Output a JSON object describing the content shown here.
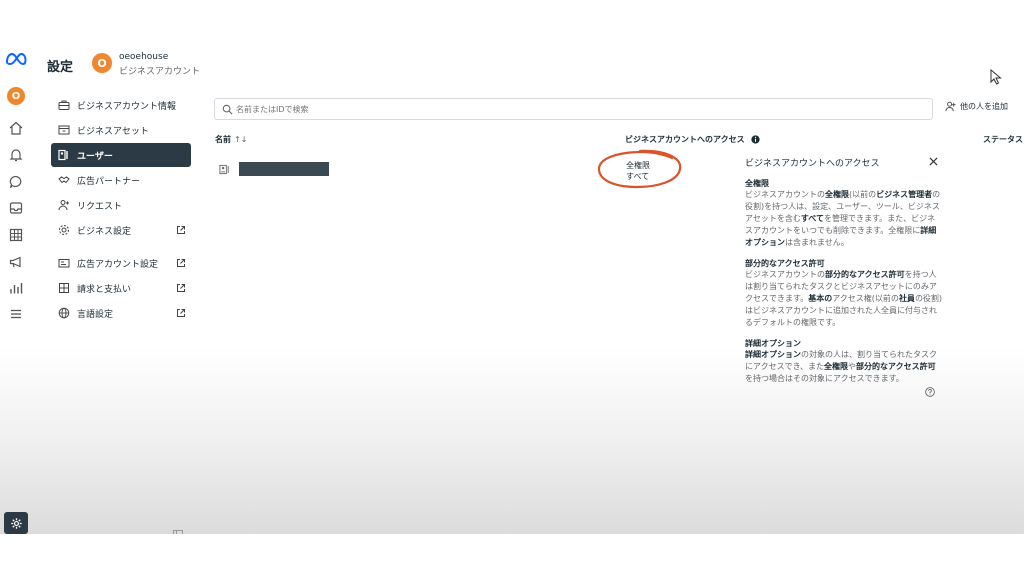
{
  "header": {
    "title": "設定",
    "account_avatar_letter": "O",
    "account_name": "oeoehouse",
    "account_type": "ビジネスアカウント"
  },
  "rail": {
    "avatar_letter": "O",
    "icons": [
      "home-icon",
      "bell-icon",
      "chat-bubble-icon",
      "inbox-icon",
      "table-icon",
      "megaphone-icon",
      "bar-chart-icon",
      "menu-icon"
    ],
    "bottom_icon": "gear-icon"
  },
  "sidebar": {
    "items": [
      {
        "label": "ビジネスアカウント情報",
        "icon": "briefcase-icon"
      },
      {
        "label": "ビジネスアセット",
        "icon": "asset-box-icon"
      },
      {
        "label": "ユーザー",
        "icon": "users-icon",
        "active": true
      },
      {
        "label": "広告パートナー",
        "icon": "handshake-icon"
      },
      {
        "label": "リクエスト",
        "icon": "person-request-icon"
      },
      {
        "label": "ビジネス設定",
        "icon": "settings-gear-icon",
        "external": true
      },
      {
        "label": "広告アカウント設定",
        "icon": "ad-account-icon",
        "external": true
      },
      {
        "label": "請求と支払い",
        "icon": "billing-icon",
        "external": true
      },
      {
        "label": "言語設定",
        "icon": "globe-icon",
        "external": true
      }
    ]
  },
  "search": {
    "placeholder": "名前またはIDで検索"
  },
  "add_person_label": "他の人を追加",
  "table": {
    "columns": {
      "name": "名前",
      "sort_indicator": "↑↓",
      "access": "ビジネスアカウントへのアクセス",
      "status": "ステータス"
    },
    "rows": [
      {
        "access_level": "全権限",
        "access_scope": "すべて"
      }
    ]
  },
  "access_panel": {
    "title": "ビジネスアカウントへのアクセス",
    "sections": [
      {
        "heading": "全権限",
        "body_parts": [
          {
            "t": "ビジネスアカウントの"
          },
          {
            "t": "全権限",
            "b": true
          },
          {
            "t": "(以前の"
          },
          {
            "t": "ビジネス管理者",
            "b": true
          },
          {
            "t": "の役割)を持つ人は、設定、ユーザー、ツール、ビジネスアセットを含む"
          },
          {
            "t": "すべて",
            "b": true
          },
          {
            "t": "を管理できます。また、ビジネスアカウントをいつでも削除できます。全権限に"
          },
          {
            "t": "詳細オプション",
            "b": true
          },
          {
            "t": "は含まれません。"
          }
        ]
      },
      {
        "heading": "部分的なアクセス許可",
        "body_parts": [
          {
            "t": "ビジネスアカウントの"
          },
          {
            "t": "部分的なアクセス許可",
            "b": true
          },
          {
            "t": "を持つ人は割り当てられたタスクとビジネスアセットにのみアクセスできます。"
          },
          {
            "t": "基本の",
            "b": true
          },
          {
            "t": "アクセス権(以前の"
          },
          {
            "t": "社員",
            "b": true
          },
          {
            "t": "の役割)はビジネスアカウントに追加された人全員に付与されるデフォルトの権限です。"
          }
        ]
      },
      {
        "heading": "詳細オプション",
        "body_parts": [
          {
            "t": "詳細オプション",
            "b": true
          },
          {
            "t": "の対象の人は、割り当てられたタスクにアクセスでき、また"
          },
          {
            "t": "全権限",
            "b": true
          },
          {
            "t": "や"
          },
          {
            "t": "部分的なアクセス許可",
            "b": true
          },
          {
            "t": "を持つ場合はその対象にアクセスできます。"
          }
        ]
      }
    ]
  },
  "colors": {
    "active_nav_bg": "#2b3a44",
    "avatar_orange": "#f0862e",
    "annotation_circle": "#d9532b",
    "meta_blue": "#0866ff"
  }
}
